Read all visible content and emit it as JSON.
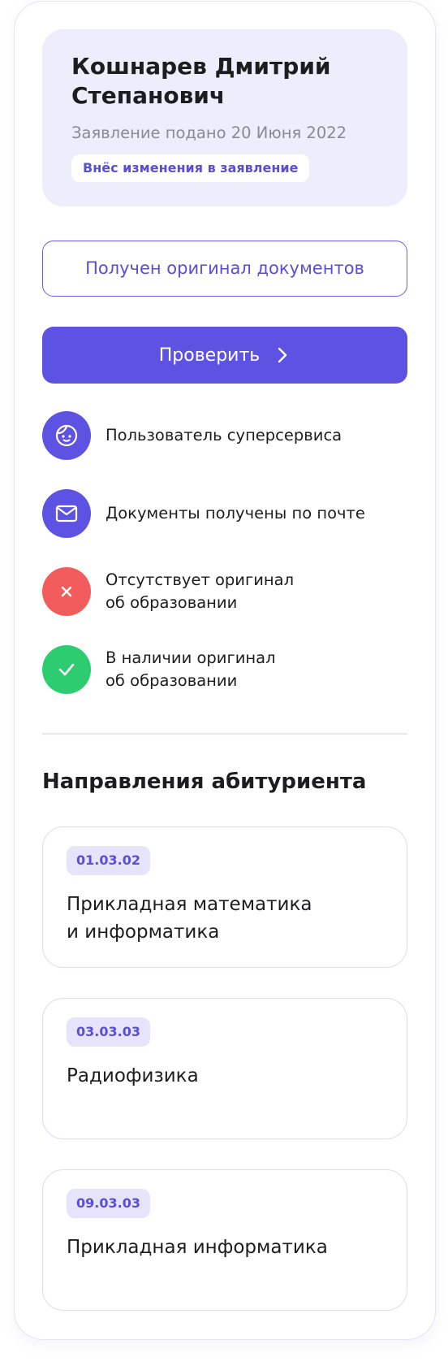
{
  "applicant": {
    "name": "Кошнарев Дмитрий Степанович",
    "date": "Заявление подано 20 Июня 2022",
    "badge": "Внёс изменения в заявление"
  },
  "buttons": {
    "original_received": "Получен оригинал документов",
    "check": "Проверить"
  },
  "legend": [
    {
      "lines": [
        "Пользователь суперсервиса"
      ],
      "icon": "smiley-face-icon",
      "color": "#5d52e2"
    },
    {
      "lines": [
        "Документы получены по почте"
      ],
      "icon": "mail-envelope-icon",
      "color": "#5d52e2"
    },
    {
      "lines": [
        "Отсутствует оригинал",
        "об образовании"
      ],
      "icon": "cross-icon",
      "color": "#f25c5c"
    },
    {
      "lines": [
        "В наличии оригинал",
        "об образовании"
      ],
      "icon": "check-icon",
      "color": "#2ecc71"
    }
  ],
  "section": {
    "title": "Направления абитуриента"
  },
  "programs": [
    {
      "code": "01.03.02",
      "lines": [
        "Прикладная математика",
        "и информатика"
      ]
    },
    {
      "code": "03.03.03",
      "lines": [
        "Радиофизика"
      ]
    },
    {
      "code": "09.03.03",
      "lines": [
        "Прикладная информатика"
      ]
    }
  ],
  "colors": {
    "accent": "#5d52e2",
    "accent_light": "#ededfb",
    "error": "#f25c5c",
    "success": "#2ecc71"
  }
}
